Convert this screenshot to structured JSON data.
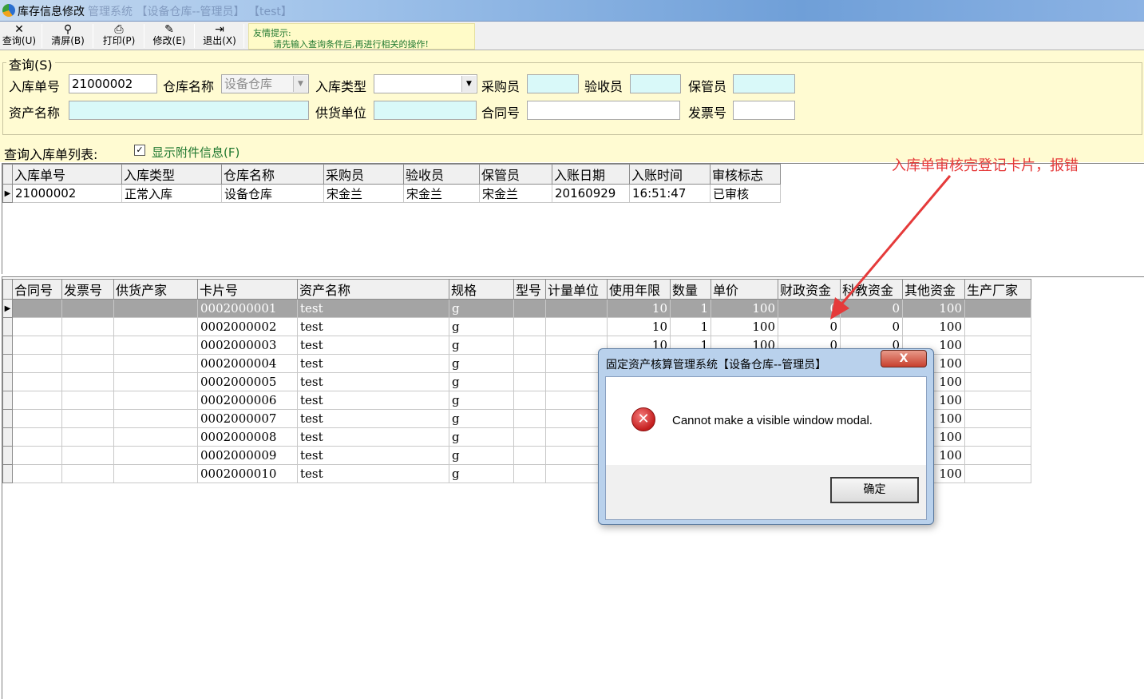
{
  "window": {
    "title": "库存信息修改",
    "ghost_title": "管理系统  【设备仓库--管理员】   【test】"
  },
  "toolbar": {
    "buttons": [
      {
        "label": "查询(U)",
        "icon": "close-icon"
      },
      {
        "label": "清屏(B)",
        "icon": "clear-icon"
      },
      {
        "label": "打印(P)",
        "icon": "printer-icon"
      },
      {
        "label": "修改(E)",
        "icon": "edit-icon"
      },
      {
        "label": "退出(X)",
        "icon": "exit-icon"
      }
    ],
    "hint_line1": "友情提示:",
    "hint_line2": "请先输入查询条件后,再进行相关的操作!"
  },
  "query": {
    "legend": "查询(S)",
    "labels": {
      "receipt_no": "入库单号",
      "warehouse": "仓库名称",
      "receipt_type": "入库类型",
      "purchaser": "采购员",
      "inspector": "验收员",
      "keeper": "保管员",
      "asset_name": "资产名称",
      "supplier": "供货单位",
      "contract_no": "合同号",
      "invoice_no": "发票号"
    },
    "values": {
      "receipt_no": "21000002",
      "warehouse": "设备仓库",
      "receipt_type": "",
      "purchaser": "",
      "inspector": "",
      "keeper": "",
      "asset_name": "",
      "supplier": "",
      "contract_no": "",
      "invoice_no": ""
    }
  },
  "list": {
    "label": "查询入库单列表:",
    "show_attach_label": "显示附件信息(F)",
    "show_attach_checked": true
  },
  "receipts": {
    "columns": [
      "入库单号",
      "入库类型",
      "仓库名称",
      "采购员",
      "验收员",
      "保管员",
      "入账日期",
      "入账时间",
      "审核标志"
    ],
    "rows": [
      [
        "21000002",
        "正常入库",
        "设备仓库",
        "宋金兰",
        "宋金兰",
        "宋金兰",
        "20160929",
        "16:51:47",
        "已审核"
      ]
    ]
  },
  "cards": {
    "columns": [
      "合同号",
      "发票号",
      "供货产家",
      "卡片号",
      "资产名称",
      "规格",
      "型号",
      "计量单位",
      "使用年限",
      "数量",
      "单价",
      "财政资金",
      "科教资金",
      "其他资金",
      "生产厂家"
    ],
    "rows": [
      [
        "",
        "",
        "",
        "0002000001",
        "test",
        "g",
        "",
        "",
        "10",
        "1",
        "100",
        "0",
        "0",
        "100",
        ""
      ],
      [
        "",
        "",
        "",
        "0002000002",
        "test",
        "g",
        "",
        "",
        "10",
        "1",
        "100",
        "0",
        "0",
        "100",
        ""
      ],
      [
        "",
        "",
        "",
        "0002000003",
        "test",
        "g",
        "",
        "",
        "10",
        "1",
        "100",
        "0",
        "0",
        "100",
        ""
      ],
      [
        "",
        "",
        "",
        "0002000004",
        "test",
        "g",
        "",
        "",
        "",
        "",
        "",
        "",
        "",
        "100",
        ""
      ],
      [
        "",
        "",
        "",
        "0002000005",
        "test",
        "g",
        "",
        "",
        "",
        "",
        "",
        "",
        "",
        "100",
        ""
      ],
      [
        "",
        "",
        "",
        "0002000006",
        "test",
        "g",
        "",
        "",
        "",
        "",
        "",
        "",
        "",
        "100",
        ""
      ],
      [
        "",
        "",
        "",
        "0002000007",
        "test",
        "g",
        "",
        "",
        "",
        "",
        "",
        "",
        "",
        "100",
        ""
      ],
      [
        "",
        "",
        "",
        "0002000008",
        "test",
        "g",
        "",
        "",
        "",
        "",
        "",
        "",
        "",
        "100",
        ""
      ],
      [
        "",
        "",
        "",
        "0002000009",
        "test",
        "g",
        "",
        "",
        "",
        "",
        "",
        "",
        "",
        "100",
        ""
      ],
      [
        "",
        "",
        "",
        "0002000010",
        "test",
        "g",
        "",
        "",
        "",
        "",
        "",
        "",
        "",
        "100",
        ""
      ]
    ]
  },
  "annotation": {
    "text": "入库单审核完登记卡片，报错",
    "color": "#e53a3a"
  },
  "dialog": {
    "title": "固定资产核算管理系统【设备仓库--管理员】",
    "message": "Cannot make a visible window modal.",
    "ok_label": "确定",
    "close_label": "X"
  }
}
